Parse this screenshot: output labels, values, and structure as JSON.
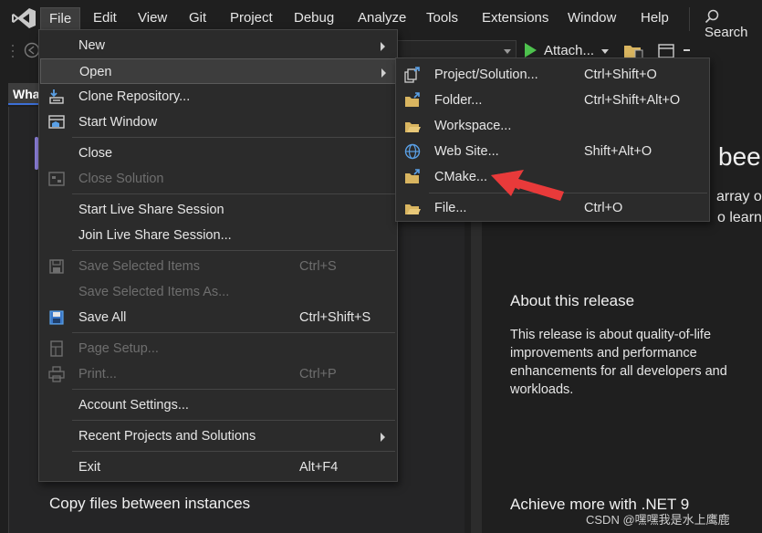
{
  "menubar": {
    "items": [
      {
        "label": "File"
      },
      {
        "label": "Edit"
      },
      {
        "label": "View"
      },
      {
        "label": "Git"
      },
      {
        "label": "Project"
      },
      {
        "label": "Debug"
      },
      {
        "label": "Analyze"
      },
      {
        "label": "Tools"
      },
      {
        "label": "Extensions"
      },
      {
        "label": "Window"
      },
      {
        "label": "Help"
      }
    ],
    "search_label": "Search"
  },
  "toolbar": {
    "attach_label": "Attach..."
  },
  "tab": {
    "label": "Wha"
  },
  "file_menu": {
    "items": [
      {
        "label": "New",
        "shortcut": "",
        "icon": "none",
        "submenu": true,
        "enabled": true
      },
      {
        "label": "Open",
        "shortcut": "",
        "icon": "none",
        "submenu": true,
        "enabled": true,
        "highlighted": true
      },
      {
        "label": "Clone Repository...",
        "shortcut": "",
        "icon": "clone-icon",
        "enabled": true
      },
      {
        "label": "Start Window",
        "shortcut": "",
        "icon": "start-window-icon",
        "enabled": true
      },
      {
        "label": "Close",
        "shortcut": "",
        "icon": "none",
        "enabled": true
      },
      {
        "label": "Close Solution",
        "shortcut": "",
        "icon": "close-solution-icon",
        "enabled": false
      },
      {
        "label": "Start Live Share Session",
        "shortcut": "",
        "icon": "none",
        "enabled": true
      },
      {
        "label": "Join Live Share Session...",
        "shortcut": "",
        "icon": "none",
        "enabled": true
      },
      {
        "label": "Save Selected Items",
        "shortcut": "Ctrl+S",
        "icon": "save-icon",
        "enabled": false
      },
      {
        "label": "Save Selected Items As...",
        "shortcut": "",
        "icon": "none",
        "enabled": false
      },
      {
        "label": "Save All",
        "shortcut": "Ctrl+Shift+S",
        "icon": "save-all-icon",
        "enabled": true
      },
      {
        "label": "Page Setup...",
        "shortcut": "",
        "icon": "page-setup-icon",
        "enabled": false
      },
      {
        "label": "Print...",
        "shortcut": "Ctrl+P",
        "icon": "print-icon",
        "enabled": false
      },
      {
        "label": "Account Settings...",
        "shortcut": "",
        "icon": "none",
        "enabled": true
      },
      {
        "label": "Recent Projects and Solutions",
        "shortcut": "",
        "icon": "none",
        "submenu": true,
        "enabled": true
      },
      {
        "label": "Exit",
        "shortcut": "Alt+F4",
        "icon": "none",
        "enabled": true
      }
    ]
  },
  "open_menu": {
    "items": [
      {
        "label": "Project/Solution...",
        "shortcut": "Ctrl+Shift+O",
        "icon": "project-solution-icon"
      },
      {
        "label": "Folder...",
        "shortcut": "Ctrl+Shift+Alt+O",
        "icon": "folder-icon"
      },
      {
        "label": "Workspace...",
        "shortcut": "",
        "icon": "workspace-icon"
      },
      {
        "label": "Web Site...",
        "shortcut": "Shift+Alt+O",
        "icon": "globe-icon"
      },
      {
        "label": "CMake...",
        "shortcut": "",
        "icon": "cmake-folder-icon"
      },
      {
        "label": "File...",
        "shortcut": "Ctrl+O",
        "icon": "file-folder-icon"
      }
    ]
  },
  "content": {
    "title_fragment": "bee",
    "line1_fragment": "array o",
    "line2_fragment": "o learn",
    "about_title": "About this release",
    "about_body": "This release is about quality-of-life improvements and performance enhancements for all developers and workloads.",
    "left_heading": "Copy files between instances",
    "right_heading": "Achieve more with .NET 9"
  },
  "watermark": "CSDN @嘿嘿我是水上鹰鹿",
  "colors": {
    "background": "#1f1f1f",
    "menu_bg": "#2b2b2b",
    "highlight": "#3d3d3d",
    "accent_play": "#4ec24e",
    "annotation_arrow": "#e83a3a"
  }
}
